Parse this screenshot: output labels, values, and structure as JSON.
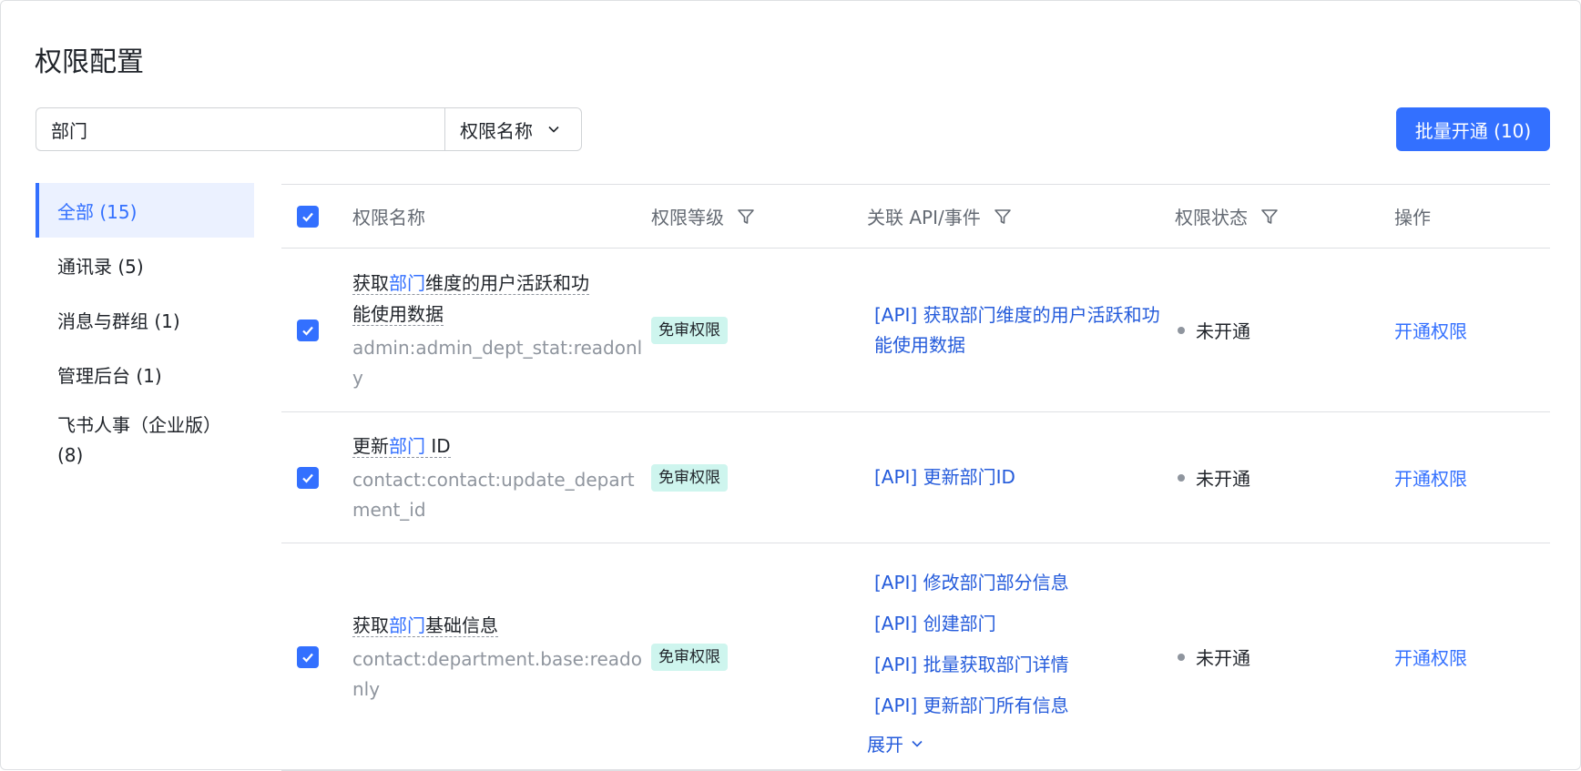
{
  "page": {
    "title": "权限配置"
  },
  "search": {
    "value": "部门",
    "select_label": "权限名称"
  },
  "batch_button": "批量开通 (10)",
  "sidebar": {
    "items": [
      {
        "label": "全部 (15)",
        "active": true
      },
      {
        "label": "通讯录 (5)"
      },
      {
        "label": "消息与群组 (1)"
      },
      {
        "label": "管理后台 (1)"
      },
      {
        "label_line1": "飞书人事（企业版）",
        "label_line2": "(8)"
      }
    ]
  },
  "table": {
    "headers": {
      "name": "权限名称",
      "level": "权限等级",
      "api": "关联 API/事件",
      "status": "权限状态",
      "op": "操作"
    },
    "rows": [
      {
        "title_pre": "获取",
        "title_hl": "部门",
        "title_post_1": "维度的用户活跃和功",
        "title_post_2": "能使用数据",
        "key": "admin:admin_dept_stat:readonly",
        "level": "免审权限",
        "apis": [
          "[API] 获取部门维度的用户活跃和功能使用数据"
        ],
        "status": "未开通",
        "op": "开通权限"
      },
      {
        "title_pre": "更新",
        "title_hl": "部门",
        "title_post_1": " ID",
        "key": "contact:contact:update_department_id",
        "level": "免审权限",
        "apis": [
          "[API] 更新部门ID"
        ],
        "status": "未开通",
        "op": "开通权限"
      },
      {
        "title_pre": "获取",
        "title_hl": "部门",
        "title_post_1": "基础信息",
        "key": "contact:department.base:readonly",
        "level": "免审权限",
        "apis": [
          "[API] 修改部门部分信息",
          "[API] 创建部门",
          "[API] 批量获取部门详情",
          "[API] 更新部门所有信息"
        ],
        "expand": "展开",
        "status": "未开通",
        "op": "开通权限"
      }
    ]
  },
  "colors": {
    "primary": "#3370ff",
    "link": "#245bdb",
    "tag_bg": "#cef5ee",
    "active_bg": "#ebf1ff"
  },
  "icons": {
    "select": "chevron-down-icon",
    "filter": "filter-icon",
    "check": "check-icon"
  }
}
